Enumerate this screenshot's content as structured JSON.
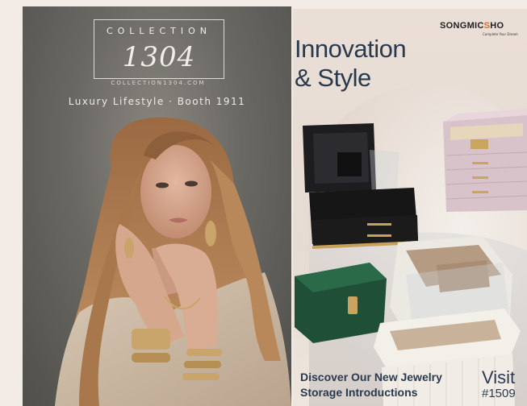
{
  "left_ad": {
    "logo_word": "COLLECTION",
    "logo_number": "1304",
    "url": "COLLECTION1304.COM",
    "tagline": "Luxury Lifestyle · Booth 1911"
  },
  "right_ad": {
    "brand": "SONGMICSHO",
    "brand_sub": "Complete Your Dream",
    "headline_line1": "Innovation",
    "headline_line2": "& Style",
    "discover_line1": "Discover Our New Jewelry",
    "discover_line2": "Storage Introductions",
    "visit": "Visit",
    "booth": "#1509"
  },
  "colors": {
    "brand_accent": "#e06a2a",
    "headline": "#2a3a4e"
  }
}
